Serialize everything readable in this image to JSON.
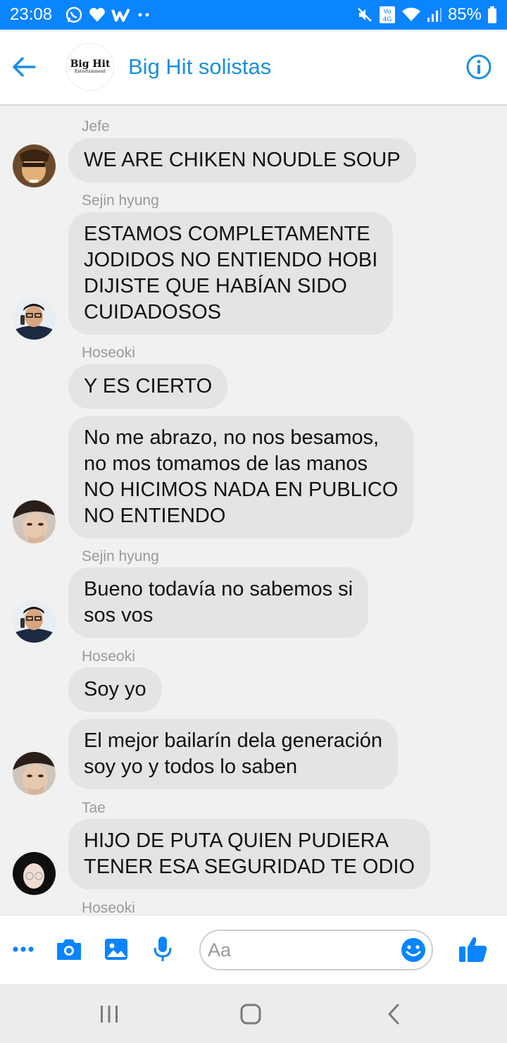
{
  "status_bar": {
    "time": "23:08",
    "network_label": "Vo) 4G",
    "battery": "85%",
    "color": "#0a84ff"
  },
  "header": {
    "group_logo_main": "Big Hit",
    "group_logo_sub": "Entertainment",
    "title": "Big Hit solistas",
    "accent_color": "#1a8fe0"
  },
  "messages": [
    {
      "sender": "Jefe",
      "text": [
        "WE ARE CHIKEN NOUDLE SOUP"
      ]
    },
    {
      "sender": "Sejin hyung",
      "text": [
        "ESTAMOS COMPLETAMENTE",
        "JODIDOS NO ENTIENDO HOBI",
        "DIJISTE QUE HABÍAN SIDO",
        "CUIDADOSOS"
      ]
    },
    {
      "sender": "Hoseoki",
      "text": [
        "Y ES CIERTO"
      ]
    },
    {
      "sender": "",
      "text": [
        "No me abrazo, no nos besamos,",
        "no mos tomamos de las manos",
        "NO HICIMOS NADA EN PUBLICO",
        "NO ENTIENDO"
      ]
    },
    {
      "sender": "Sejin hyung",
      "text": [
        "Bueno todavía no sabemos si",
        "sos vos"
      ]
    },
    {
      "sender": "Hoseoki",
      "text": [
        "Soy yo"
      ]
    },
    {
      "sender": "",
      "text": [
        "El mejor bailarín dela generación",
        "soy yo y todos lo saben"
      ]
    },
    {
      "sender": "Tae",
      "text": [
        "HIJO DE PUTA QUIEN PUDIERA",
        "TENER ESA SEGURIDAD TE ODIO"
      ]
    },
    {
      "sender": "Hoseoki",
      "text": []
    }
  ],
  "composer": {
    "placeholder": "Aa",
    "icons": [
      "more-icon",
      "camera-icon",
      "image-icon",
      "microphone-icon",
      "emoji-icon",
      "like-icon"
    ]
  },
  "navbar": {
    "icons": [
      "recent-apps-icon",
      "home-icon",
      "back-nav-icon"
    ]
  },
  "colors": {
    "bubble": "#e4e4e4",
    "chat_background": "#f1f1f1",
    "messenger_blue": "#0a84ff"
  }
}
